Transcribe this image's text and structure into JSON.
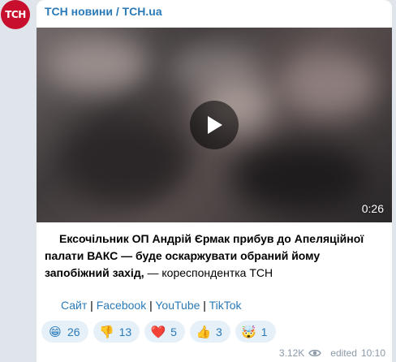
{
  "channel": {
    "avatar_text": "ТСН",
    "name": "ТСН новини / TCH.ua",
    "brand_color": "#c8102e",
    "link_color": "#2a7ab8"
  },
  "video": {
    "duration": "0:26",
    "icon": "play-icon"
  },
  "message": {
    "bold_text": "Ексочільник ОП Андрій Єрмак прибув до Апеляційної палати ВАКС — буде оскаржувати обраний йому запобіжний захід,",
    "plain_text": " — кореспондентка ТСН"
  },
  "links": {
    "items": [
      "Сайт",
      "Facebook",
      "YouTube",
      "TikTok"
    ],
    "separator": " | "
  },
  "reactions": [
    {
      "emoji": "😁",
      "icon": "grinning-face-icon",
      "count": "26"
    },
    {
      "emoji": "👎",
      "icon": "thumbs-down-icon",
      "count": "13"
    },
    {
      "emoji": "❤️",
      "icon": "red-heart-icon",
      "count": "5"
    },
    {
      "emoji": "👍",
      "icon": "thumbs-up-icon",
      "count": "3"
    },
    {
      "emoji": "🤯",
      "icon": "exploding-head-icon",
      "count": "1"
    }
  ],
  "meta": {
    "views": "3.12K",
    "views_icon": "eye-icon",
    "edited": "edited",
    "time": "10:10"
  }
}
